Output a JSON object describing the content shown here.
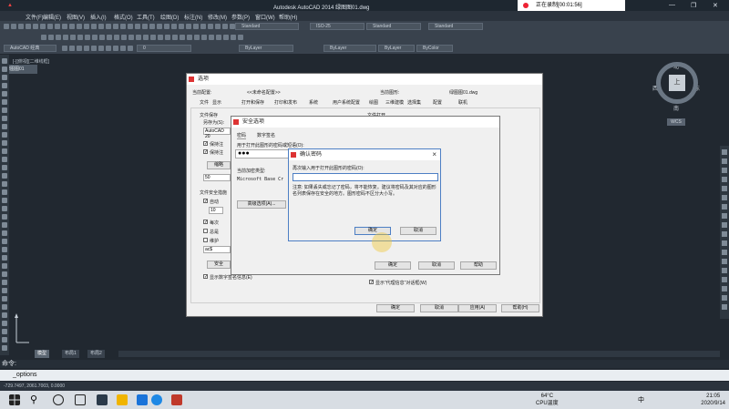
{
  "window": {
    "title": "Autodesk AutoCAD 2014   绿图图01.dwg",
    "recording": "正在录制[00:01:56]"
  },
  "menu": [
    "文件(F)",
    "编辑(E)",
    "视图(V)",
    "插入(I)",
    "格式(O)",
    "工具(T)",
    "绘图(D)",
    "标注(N)",
    "修改(M)",
    "参数(P)",
    "窗口(W)",
    "帮助(H)"
  ],
  "toolbar": {
    "workspace": "AutoCAD 经典",
    "layer": "0",
    "bylayer1": "ByLayer",
    "bylayer2": "ByLayer",
    "bylayer3": "ByLayer",
    "bycolor": "ByColor",
    "textstyle": "Standard",
    "dimstyle": "ISO-25",
    "tablestyle": "Standard",
    "mleaderstyle": "Standard"
  },
  "doc_tab": "绿图图01",
  "viewport_label": "[-][俯视][二维线框]",
  "viewcube": {
    "north": "北",
    "south": "南",
    "east": "东",
    "west": "西",
    "center": "上",
    "wcs": "WCS"
  },
  "layout_tabs": [
    "模型",
    "布局1",
    "布局2"
  ],
  "command": {
    "label": "命令:",
    "input": "_options"
  },
  "status": "-729.7497, 2061.7003, 0.0000",
  "options": {
    "title": "选项",
    "current_config_label": "当前配置:",
    "current_config": "<<未命名配置>>",
    "current_drawing_label": "当前图形:",
    "current_drawing": "绿图图01.dwg",
    "tabs": [
      "文件",
      "显示",
      "打开和保存",
      "打印和发布",
      "系统",
      "用户系统配置",
      "绘图",
      "三维建模",
      "选择集",
      "配置",
      "联机"
    ],
    "file_save": "文件保存",
    "save_as": "另存为(S):",
    "save_as_value": "AutoCAD 20",
    "file_open": "文件打开",
    "cb_save1": "保持注",
    "cb_save2": "保持注",
    "thumb_btn": "缩略",
    "inc_value": "50",
    "file_safety": "文件安全措施",
    "cb_auto": "自动",
    "val_10": "10",
    "cb_every": "每次",
    "cb_always": "总是",
    "cb_maintain": "维护",
    "ext_value": "ac$",
    "security_btn": "安全",
    "cb_digsig": "显示数字签名信息(E)",
    "cb_proxy": "显示“代理信息”对话框(W)",
    "ok": "确定",
    "cancel": "取消",
    "apply": "应用(A)",
    "help": "帮助(H)"
  },
  "security": {
    "title": "安全选项",
    "tab_password": "密码",
    "tab_digsig": "数字签名",
    "open_pwd_label": "用于打开此图形的密码或短语(O):",
    "open_pwd_value": "●●●",
    "enc_type_label": "当前加密类型:",
    "enc_type_value": "Microsoft Base Cr",
    "advanced": "高级选项(A)...",
    "ok": "确定",
    "cancel": "取消",
    "help": "帮助"
  },
  "confirm": {
    "title": "确认密码",
    "prompt": "再次输入用于打开此图形的密码(O):",
    "warning": "注意: 如果丢失或忘记了密码，将不能恢复。建议将密码及其对应的图形名列表保存在安全的地方。图形密码不区分大小写。",
    "ok": "确定",
    "cancel": "取消"
  },
  "taskbar": {
    "weather_temp": "64°C",
    "weather_label": "CPU温度",
    "lang": "中",
    "time": "21:05",
    "date": "2020/9/14"
  }
}
